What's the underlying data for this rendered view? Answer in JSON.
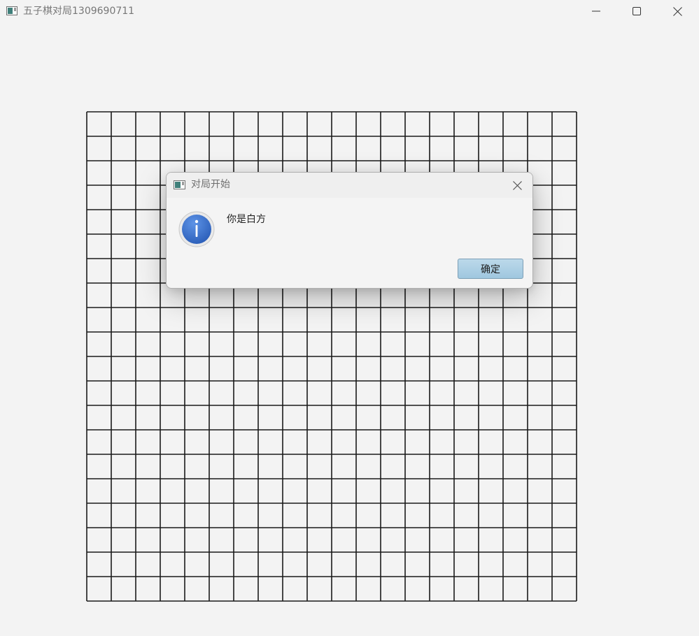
{
  "window": {
    "title": "五子棋对局1309690711",
    "controls": {
      "minimize_icon": "minimize-icon",
      "maximize_icon": "maximize-icon",
      "close_icon": "close-icon"
    }
  },
  "board": {
    "rows": 20,
    "columns": 20,
    "line_color": "#1a1a1a"
  },
  "dialog": {
    "title": "对局开始",
    "message": "你是白方",
    "ok_label": "确定",
    "icon": "info-icon",
    "close_icon": "close-icon",
    "accent_color": "#3a6fc8",
    "button_color": "#a9cfe4"
  }
}
